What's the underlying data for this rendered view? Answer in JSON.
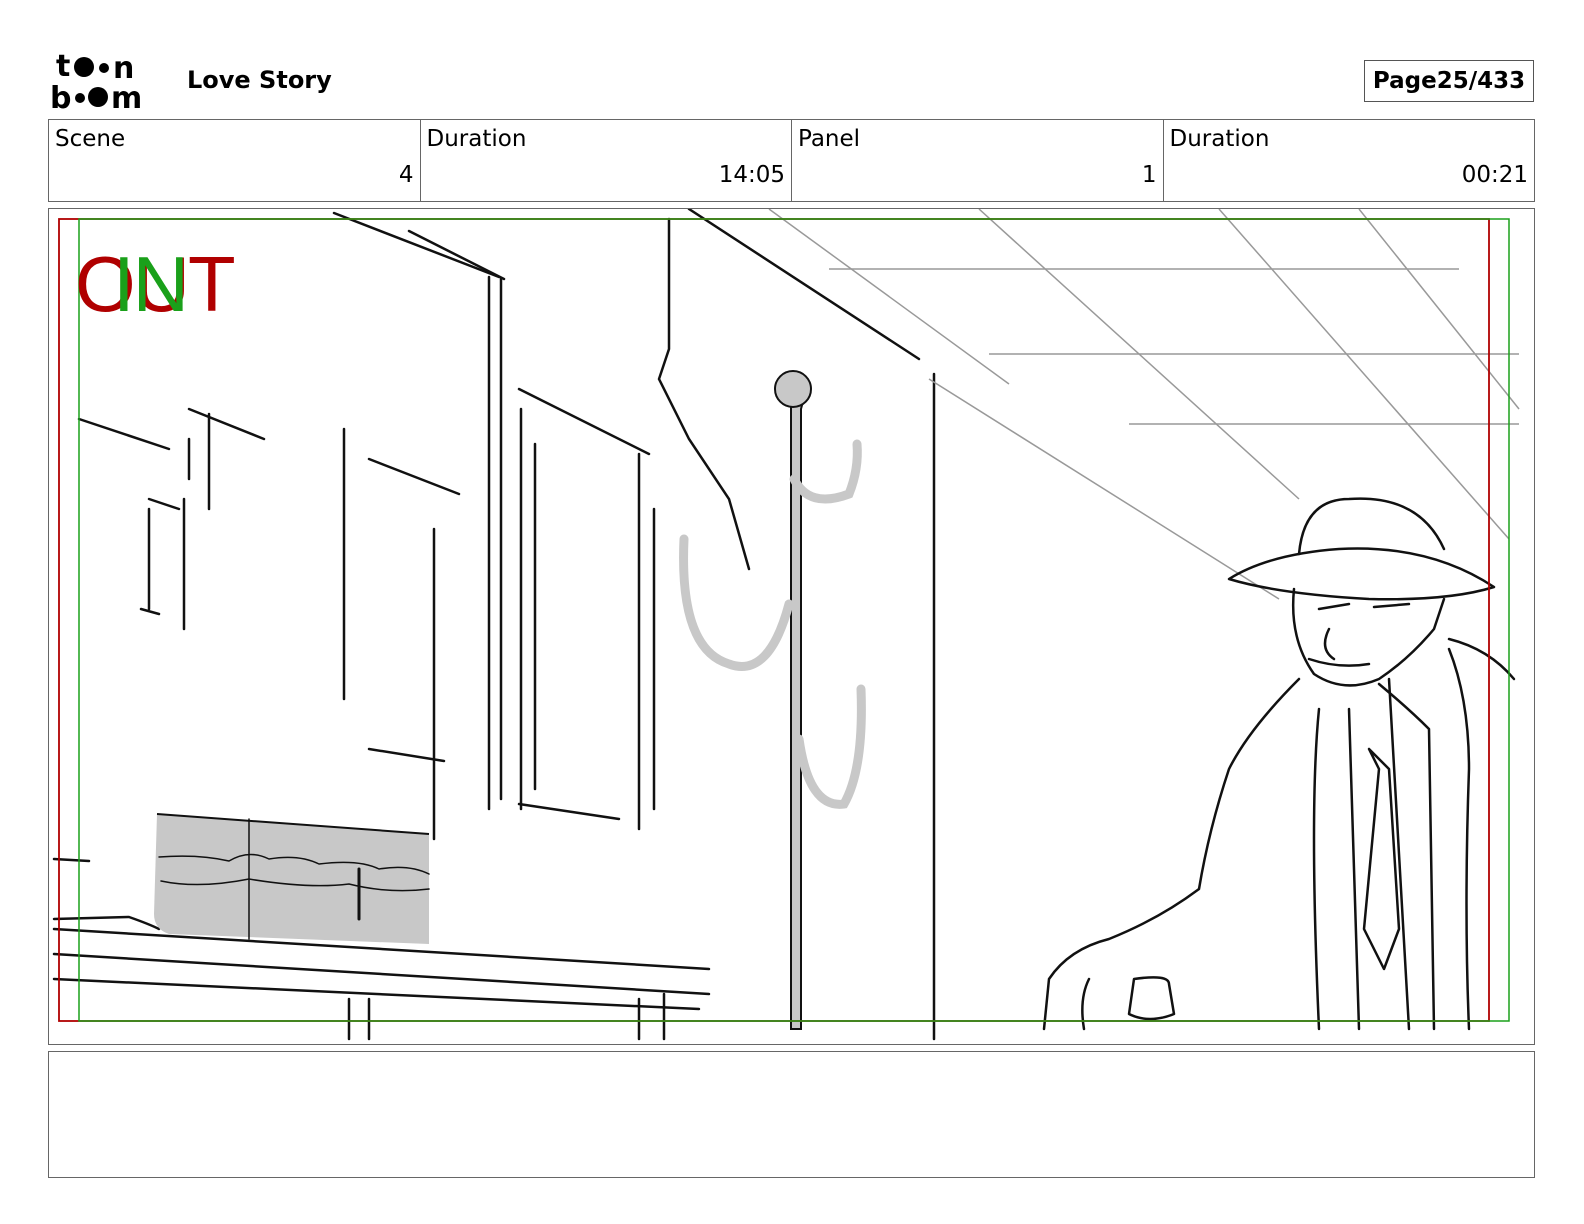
{
  "header": {
    "logo_text": "toonboom",
    "project_title": "Love Story",
    "page_label": "Page",
    "page_value": "25/433"
  },
  "info": {
    "scene_label": "Scene",
    "scene_value": "4",
    "scene_duration_label": "Duration",
    "scene_duration_value": "14:05",
    "panel_label": "Panel",
    "panel_value": "1",
    "panel_duration_label": "Duration",
    "panel_duration_value": "00:21"
  },
  "panel": {
    "out_marker": "OUT",
    "in_marker": "IN",
    "safe_frame_color": "#b00000",
    "in_frame_color": "#1aa01a",
    "sketch_fill": "#c8c8c8"
  },
  "notes": {
    "text": ""
  }
}
